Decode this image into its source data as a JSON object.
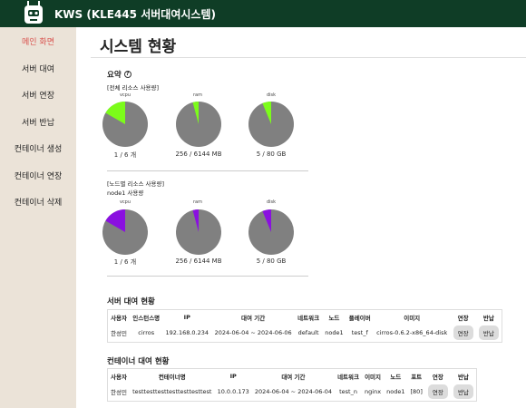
{
  "header": {
    "title": "KWS (KLE445 서버대여시스템)"
  },
  "sidebar": {
    "items": [
      {
        "label": "메인 화면"
      },
      {
        "label": "서버 대여"
      },
      {
        "label": "서버 연장"
      },
      {
        "label": "서버 반납"
      },
      {
        "label": "컨테이너 생성"
      },
      {
        "label": "컨테이너 연장"
      },
      {
        "label": "컨테이너 삭제"
      }
    ]
  },
  "main": {
    "page_title": "시스템 현황",
    "summary_title": "요약",
    "total_usage_label": "[전체 리소스 사용량]",
    "node_usage_label": "[노드별 리소스 사용량]",
    "node_name": "node1 사용량",
    "pie_names": [
      "vcpu",
      "ram",
      "disk"
    ],
    "total_caps": [
      "1 / 6 개",
      "256 / 6144 MB",
      "5 / 80 GB"
    ],
    "node_caps": [
      "1 / 6 개",
      "256 / 6144 MB",
      "5 / 80 GB"
    ],
    "server_title": "서버 대여 현황",
    "server_headers": [
      "사용자",
      "인스턴스명",
      "IP",
      "대여 기간",
      "네트워크",
      "노드",
      "플레이버",
      "이미지",
      "연장",
      "반납"
    ],
    "server_row": [
      "한성민",
      "cirros",
      "192.168.0.234",
      "2024-06-04 ~ 2024-06-06",
      "default",
      "node1",
      "test_f",
      "cirros-0.6.2-x86_64-disk"
    ],
    "container_title": "컨테이너 대여 현황",
    "container_headers": [
      "사용자",
      "컨테이너명",
      "IP",
      "대여 기간",
      "네트워크",
      "이미지",
      "노드",
      "포트",
      "연장",
      "반납"
    ],
    "container_row": [
      "한성민",
      "testtesttesttesttesttesttest",
      "10.0.0.173",
      "2024-06-04 ~ 2024-06-04",
      "test_n",
      "nginx",
      "node1",
      "[80]"
    ],
    "extend_label": "연장",
    "return_label": "반납"
  },
  "colors": {
    "topbar": "#0f3d26",
    "sidebar": "#ebe3d8",
    "total_fill": "#7cfc1a",
    "node_fill": "#8a10e0",
    "pie_base": "#808080",
    "active_nav": "#d9534f"
  },
  "usage": {
    "vcpu": 0.1667,
    "ram": 0.0417,
    "disk": 0.0625
  }
}
